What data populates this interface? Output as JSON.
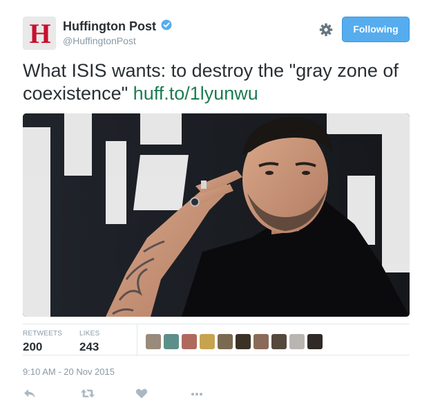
{
  "account": {
    "avatar_letter": "H",
    "display_name": "Huffington Post",
    "handle": "@HuffingtonPost",
    "verified_icon": "verified-badge-icon"
  },
  "header": {
    "follow_label": "Following"
  },
  "tweet": {
    "text": "What ISIS wants: to destroy the \"gray zone of coexistence\" ",
    "link": "huff.to/1lyunwu"
  },
  "stats": {
    "retweets_label": "RETWEETS",
    "retweets_value": "200",
    "likes_label": "LIKES",
    "likes_value": "243"
  },
  "timestamp": "9:10 AM - 20 Nov 2015",
  "colors": {
    "follow_button": "#55acee",
    "link": "#1c7c54",
    "muted": "#8899a6",
    "liker_avatars": [
      "#9a8a7a",
      "#5d8f8a",
      "#b06a5c",
      "#c7a34f",
      "#7a6a52",
      "#3b3226",
      "#8a6b58",
      "#55483d",
      "#b9b5b0",
      "#2f2a26"
    ]
  },
  "actions": {
    "icons": [
      "reply-icon",
      "retweet-icon",
      "like-icon",
      "more-icon"
    ]
  }
}
